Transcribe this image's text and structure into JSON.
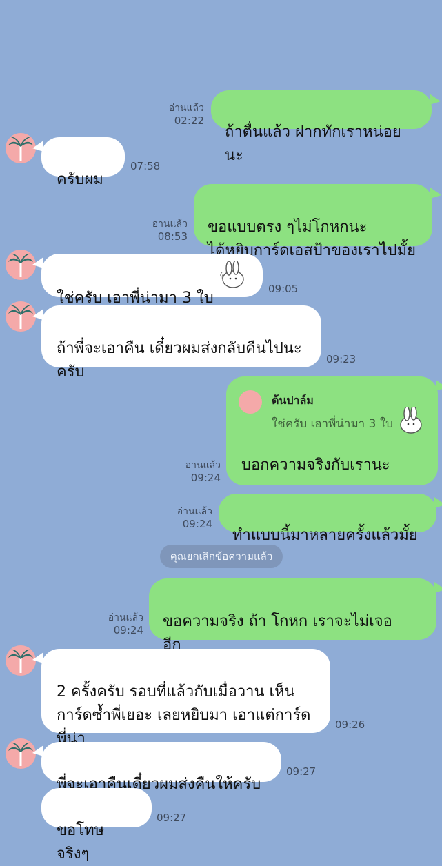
{
  "contact": {
    "name": "ต้นปาล์ม"
  },
  "system_message": "คุณยกเลิกข้อความแล้ว",
  "messages": [
    {
      "side": "out",
      "text": "ถ้าตื่นแล้ว ฝากทักเราหน่อยนะ",
      "read": "อ่านแล้ว",
      "time": "02:22"
    },
    {
      "side": "in",
      "text": "ครับผม",
      "time": "07:58"
    },
    {
      "side": "out",
      "text": "ขอแบบตรง ๆไม่โกหกนะ\nได้หยิบการ์ดเอสป้าของเราไปมั้ย",
      "read": "อ่านแล้ว",
      "time": "08:53"
    },
    {
      "side": "in",
      "text": "ใช่ครับ เอาพี่น่ามา 3 ใบ",
      "time": "09:05",
      "sticker": "bunny-sticker"
    },
    {
      "side": "in",
      "text": "ถ้าพี่จะเอาคืน เดี๋ยวผมส่งกลับคืนไปนะ\nครับ",
      "time": "09:23"
    },
    {
      "side": "out",
      "reply_to": {
        "name": "ต้นปาล์ม",
        "text": "ใช่ครับ เอาพี่น่ามา 3 ใบ"
      },
      "text": "บอกความจริงกับเรานะ",
      "read": "อ่านแล้ว",
      "time": "09:24"
    },
    {
      "side": "out",
      "text": "ทำแบบนี้มาหลายครั้งแล้วมั้ย",
      "read": "อ่านแล้ว",
      "time": "09:24"
    },
    {
      "side": "out",
      "text": "ขอความจริง ถ้า            โกหก เราจะไม่เจอ\n          อีก",
      "read": "อ่านแล้ว",
      "time": "09:24"
    },
    {
      "side": "in",
      "text": "2 ครั้งครับ รอบที่แล้วกับเมื่อวาน เห็น\nการ์ดซ้ำพี่เยอะ เลยหยิบมา เอาแต่การ์ด\nพี่น่า",
      "time": "09:26"
    },
    {
      "side": "in",
      "text": "พี่จะเอาคืนเดี๋ยวผมส่งคืนให้ครับ",
      "time": "09:27"
    },
    {
      "side": "in",
      "text": "ขอโทษจริงๆ",
      "time": "09:27"
    }
  ],
  "colors": {
    "background": "#8facd6",
    "incoming": "#ffffff",
    "outgoing": "#8de181",
    "avatar": "#f4a9a9"
  },
  "icons": {
    "avatar": "palm-tree-icon",
    "sticker": "bunny-sticker"
  }
}
